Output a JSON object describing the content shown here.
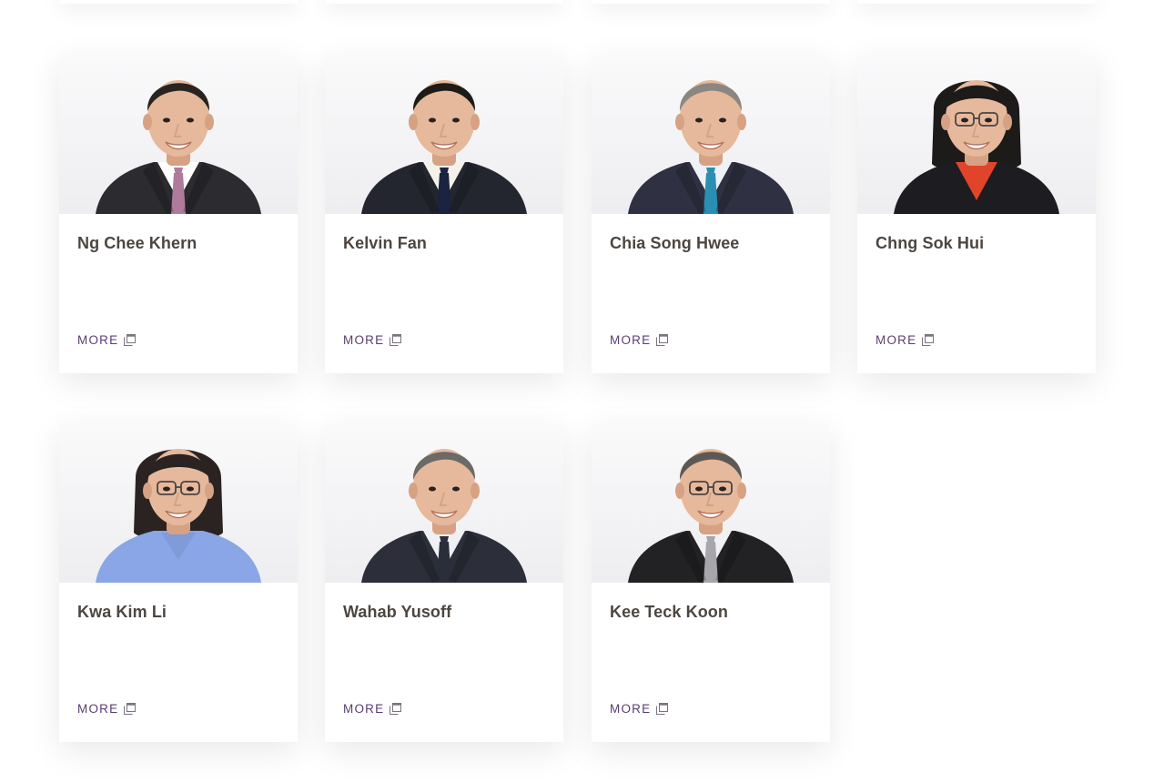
{
  "people": [
    {
      "name": "Ng Chee Khern",
      "more_label": "MORE",
      "tie": "#b07a9c",
      "hair": "#2a2420",
      "suit": "#2b2b30",
      "shirt": "#ffffff",
      "glasses": false,
      "female": false
    },
    {
      "name": "Kelvin Fan",
      "more_label": "MORE",
      "tie": "#1c2340",
      "hair": "#1e1a17",
      "suit": "#23262e",
      "shirt": "#f4f1ea",
      "glasses": false,
      "female": false
    },
    {
      "name": "Chia Song Hwee",
      "more_label": "MORE",
      "tie": "#2a8fb3",
      "hair": "#8b8780",
      "suit": "#2f3142",
      "shirt": "#eef1f6",
      "glasses": false,
      "female": false
    },
    {
      "name": "Chng Sok Hui",
      "more_label": "MORE",
      "tie": "#e0452b",
      "hair": "#1d1a1a",
      "suit": "#1d1c20",
      "shirt": "#e0452b",
      "glasses": true,
      "female": true
    },
    {
      "name": "Kwa Kim Li",
      "more_label": "MORE",
      "tie": "#7f9bd8",
      "hair": "#2a2322",
      "suit": "#8aa6e6",
      "shirt": "#8aa6e6",
      "glasses": true,
      "female": true
    },
    {
      "name": "Wahab Yusoff",
      "more_label": "MORE",
      "tie": "#2a2d3a",
      "hair": "#6c6a66",
      "suit": "#2c2f3a",
      "shirt": "#eef0f4",
      "glasses": false,
      "female": false
    },
    {
      "name": "Kee Teck Koon",
      "more_label": "MORE",
      "tie": "#a7a7ab",
      "hair": "#5c5955",
      "suit": "#222224",
      "shirt": "#f1f1f3",
      "glasses": true,
      "female": false
    }
  ]
}
